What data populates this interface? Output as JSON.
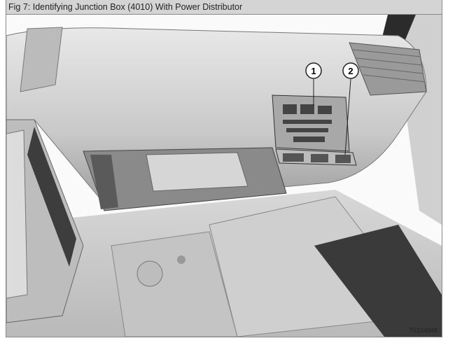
{
  "figure": {
    "caption": "Fig 7: Identifying Junction Box (4010) With Power Distributor",
    "callouts": [
      "1",
      "2"
    ],
    "figure_id": "T6104948"
  }
}
